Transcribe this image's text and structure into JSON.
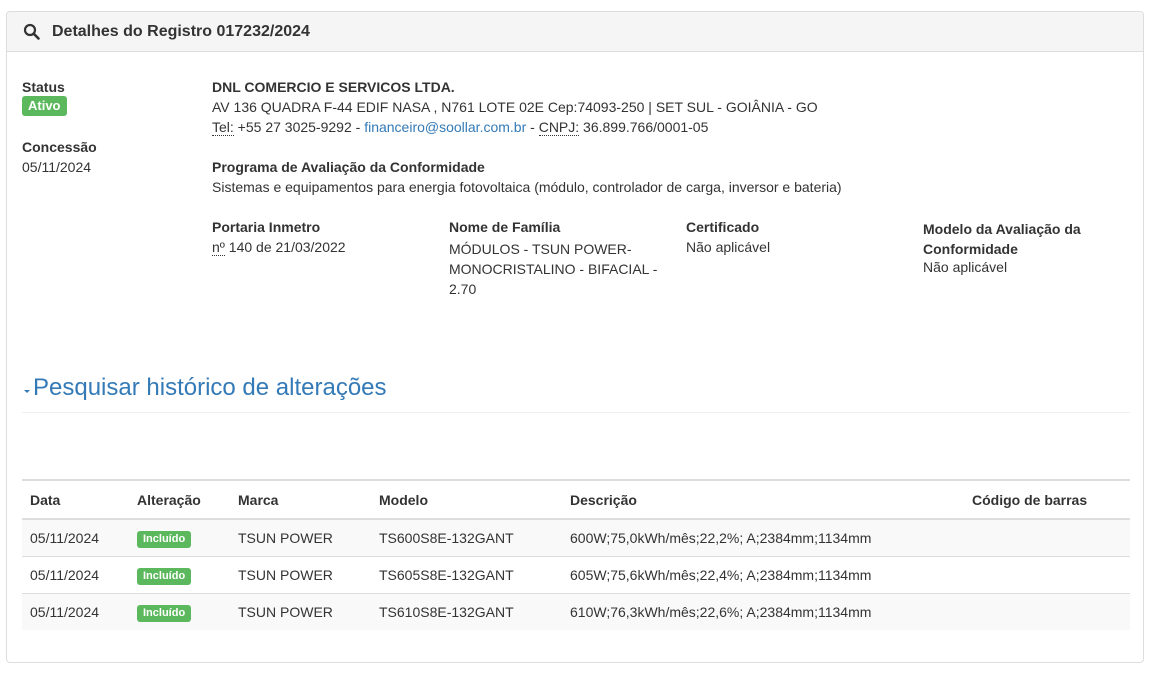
{
  "panel": {
    "title": "Detalhes do Registro 017232/2024",
    "icon": "search-icon"
  },
  "status": {
    "label": "Status",
    "value": "Ativo",
    "color": "#5cb85c"
  },
  "concessao": {
    "label": "Concessão",
    "value": "05/11/2024"
  },
  "company": {
    "name": "DNL COMERCIO E SERVICOS LTDA.",
    "address": "AV 136 QUADRA F-44 EDIF NASA , N761 LOTE 02E Cep:74093-250 | SET SUL - GOIÂNIA - GO",
    "tel_label": "Tel:",
    "tel_value": " +55 27 3025-9292 - ",
    "email": "financeiro@soollar.com.br",
    "cnpj_sep": " - ",
    "cnpj_label": "CNPJ:",
    "cnpj_value": " 36.899.766/0001-05"
  },
  "programa": {
    "label": "Programa de Avaliação da Conformidade",
    "value": "Sistemas e equipamentos para energia fotovoltaica (módulo, controlador de carga, inversor e bateria)"
  },
  "portaria": {
    "label": "Portaria Inmetro",
    "num_abbr": "nº",
    "value": " 140 de 21/03/2022"
  },
  "familia": {
    "label": "Nome de Família",
    "value": "MÓDULOS - TSUN POWER-MONOCRISTALINO - BIFACIAL - 2.70"
  },
  "certificado": {
    "label": "Certificado",
    "value": "Não aplicável"
  },
  "modelo_avaliacao": {
    "label": "Modelo da Avaliação da Conformidade",
    "value": "Não aplicável"
  },
  "historico": {
    "title": "Pesquisar histórico de alterações",
    "toggle_icon": "caret-down-icon"
  },
  "table": {
    "headers": [
      "Data",
      "Alteração",
      "Marca",
      "Modelo",
      "Descrição",
      "Código de barras"
    ],
    "rows": [
      {
        "data": "05/11/2024",
        "alteracao": "Incluído",
        "marca": "TSUN POWER",
        "modelo": "TS600S8E-132GANT",
        "descricao": "600W;75,0kWh/mês;22,2%; A;2384mm;1134mm",
        "codigo": ""
      },
      {
        "data": "05/11/2024",
        "alteracao": "Incluído",
        "marca": "TSUN POWER",
        "modelo": "TS605S8E-132GANT",
        "descricao": "605W;75,6kWh/mês;22,4%; A;2384mm;1134mm",
        "codigo": ""
      },
      {
        "data": "05/11/2024",
        "alteracao": "Incluído",
        "marca": "TSUN POWER",
        "modelo": "TS610S8E-132GANT",
        "descricao": "610W;76,3kWh/mês;22,6%; A;2384mm;1134mm",
        "codigo": ""
      }
    ]
  }
}
